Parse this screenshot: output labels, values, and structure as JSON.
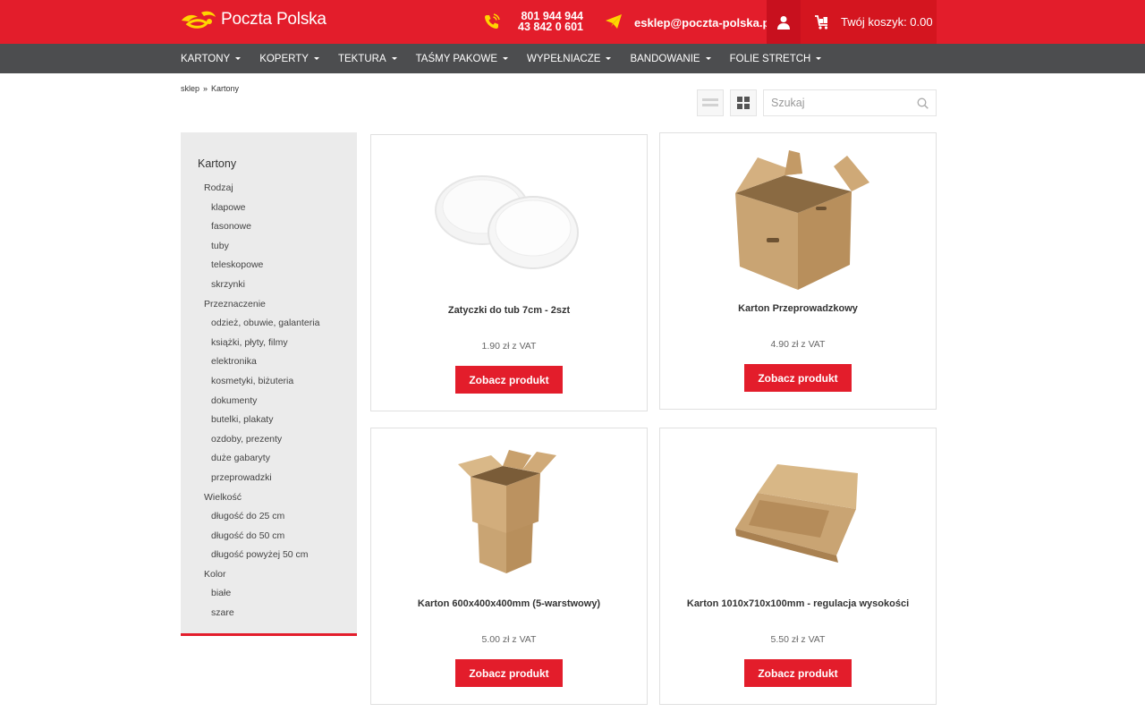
{
  "header": {
    "logo_text": "Poczta Polska",
    "phone_1": "801 944 944",
    "phone_2": "43 842 0 601",
    "email": "esklep@poczta-polska.pl",
    "cart_label": "Twój koszyk: 0.00",
    "icons": {
      "phone": "phone-icon",
      "mail": "paper-plane-icon",
      "user": "user-icon",
      "cart": "cart-icon"
    }
  },
  "nav": {
    "items": [
      {
        "label": "KARTONY"
      },
      {
        "label": "KOPERTY"
      },
      {
        "label": "TEKTURA"
      },
      {
        "label": "TAŚMY PAKOWE"
      },
      {
        "label": "WYPEŁNIACZE"
      },
      {
        "label": "BANDOWANIE"
      },
      {
        "label": "FOLIE STRETCH"
      }
    ]
  },
  "breadcrumb": {
    "home": "sklep",
    "separator": "»",
    "current": "Kartony"
  },
  "search": {
    "placeholder": "Szukaj",
    "value": ""
  },
  "sidebar": {
    "title": "Kartony",
    "items": [
      {
        "label": "Rodzaj",
        "level": 1
      },
      {
        "label": "klapowe",
        "level": 2
      },
      {
        "label": "fasonowe",
        "level": 2
      },
      {
        "label": "tuby",
        "level": 2
      },
      {
        "label": "teleskopowe",
        "level": 2
      },
      {
        "label": "skrzynki",
        "level": 2
      },
      {
        "label": "Przeznaczenie",
        "level": 1
      },
      {
        "label": "odzież, obuwie, galanteria",
        "level": 2
      },
      {
        "label": "książki, płyty, filmy",
        "level": 2
      },
      {
        "label": "elektronika",
        "level": 2
      },
      {
        "label": "kosmetyki, biżuteria",
        "level": 2
      },
      {
        "label": "dokumenty",
        "level": 2
      },
      {
        "label": "butelki, plakaty",
        "level": 2
      },
      {
        "label": "ozdoby, prezenty",
        "level": 2
      },
      {
        "label": "duże gabaryty",
        "level": 2
      },
      {
        "label": "przeprowadzki",
        "level": 2
      },
      {
        "label": "Wielkość",
        "level": 1
      },
      {
        "label": "długość do 25 cm",
        "level": 2
      },
      {
        "label": "długość do 50 cm",
        "level": 2
      },
      {
        "label": "długość powyżej 50 cm",
        "level": 2
      },
      {
        "label": "Kolor",
        "level": 1
      },
      {
        "label": "białe",
        "level": 2
      },
      {
        "label": "szare",
        "level": 2
      }
    ]
  },
  "products": [
    {
      "name": "Zatyczki do tub 7cm - 2szt",
      "price": "1.90 zł z VAT",
      "button": "Zobacz produkt"
    },
    {
      "name": "Karton Przeprowadzkowy",
      "price": "4.90 zł z VAT",
      "button": "Zobacz produkt"
    },
    {
      "name": "Karton 600x400x400mm (5-warstwowy)",
      "price": "5.00 zł z VAT",
      "button": "Zobacz produkt"
    },
    {
      "name": "Karton 1010x710x100mm - regulacja wysokości",
      "price": "5.50 zł z VAT",
      "button": "Zobacz produkt"
    }
  ],
  "colors": {
    "brand_red": "#e31d2b",
    "nav_gray": "#4c4d4f",
    "logo_yellow": "#ffd500"
  }
}
